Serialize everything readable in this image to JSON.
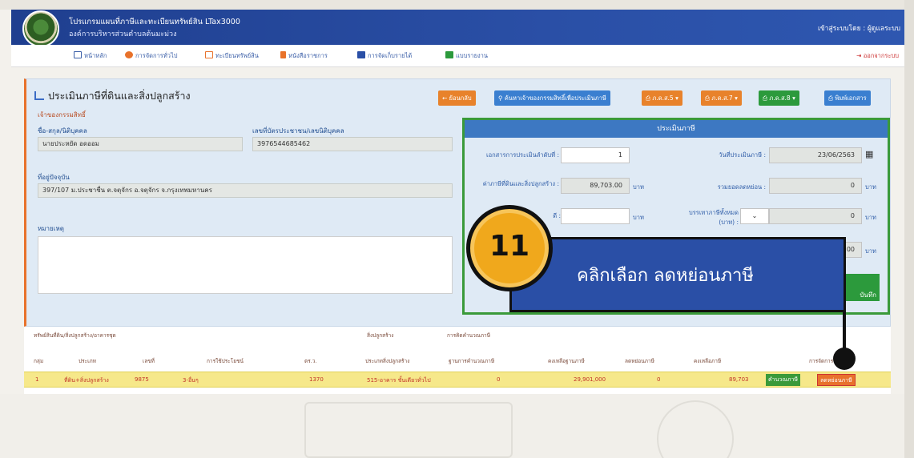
{
  "header": {
    "app_title": "โปรแกรมแผนที่ภาษีและทะเบียนทรัพย์สิน LTax3000",
    "org_name": "องค์การบริหารส่วนตำบลต้นมะม่วง",
    "login_info": "เข้าสู่ระบบโดย : ผู้ดูแลระบบ"
  },
  "nav": {
    "items": [
      {
        "label": "หน้าหลัก",
        "icon": "home-icon"
      },
      {
        "label": "การจัดการทั่วไป",
        "icon": "gear-icon"
      },
      {
        "label": "ทะเบียนทรัพย์สิน",
        "icon": "book-icon"
      },
      {
        "label": "หนังสือราชการ",
        "icon": "document-icon"
      },
      {
        "label": "การจัดเก็บรายได้",
        "icon": "calculator-icon"
      },
      {
        "label": "แบบรายงาน",
        "icon": "report-icon"
      }
    ],
    "logout": "ออกจากระบบ"
  },
  "panel": {
    "title": "ประเมินภาษีที่ดินและสิ่งปลูกสร้าง",
    "toolbar": {
      "back": "ย้อนกลับ",
      "search": "ค้นหาเจ้าของกรรมสิทธิ์เพื่อประเมินภาษี",
      "form5": "ภ.ด.ส.5",
      "form7": "ภ.ด.ส.7",
      "form8": "ภ.ด.ส.8",
      "print": "พิมพ์เอกสาร"
    },
    "owner_section": "เจ้าของกรรมสิทธิ์",
    "name_label": "ชื่อ-สกุล/นิติบุคคล",
    "name_value": "นายประหยัด อดออม",
    "id_label": "เลขที่บัตรประชาชน/เลขนิติบุคคล",
    "id_value": "3976544685462",
    "address_label": "ที่อยู่ปัจจุบัน",
    "address_value": "397/107 ม.ประชาชื่น ต.จตุจักร อ.จตุจักร จ.กรุงเทพมหานคร",
    "notes_label": "หมายเหตุ"
  },
  "assess": {
    "title": "ประเมินภาษี",
    "doc_no_label": "เอกสารการประเมินลำดับที่ :",
    "doc_no_value": "1",
    "date_label": "วันที่ประเมินภาษี :",
    "date_value": "23/06/2563",
    "tax_label": "ค่าภาษีที่ดินและสิ่งปลูกสร้าง :",
    "tax_value": "89,703.00",
    "unit_baht": "บาท",
    "discount_label": "รวมยอดลดหย่อน :",
    "discount_value": "0",
    "exempt_label": "บรรเทาภาษีทั้งหมด (บาท) :",
    "exempt_value": "0",
    "partial_label": "ดี :",
    "partial_value": "00",
    "save_button": "บันทึก"
  },
  "callout": {
    "step": "11",
    "text": "คลิกเลือก ลดหย่อนภาษี"
  },
  "table": {
    "group1": "ทรัพย์สินที่ดิน/สิ่งปลูกสร้าง/อาคารชุด",
    "group2": "สิ่งปลูกสร้าง",
    "group3": "การคิดคำนวณภาษี",
    "columns": [
      "กลุ่ม",
      "ประเภท",
      "เลขที่",
      "การใช้ประโยชน์",
      "ตร.ว.",
      "ประเภทสิ่งปลูกสร้าง",
      "ฐานการคำนวณภาษี",
      "คงเหลือฐานภาษี",
      "ลดหย่อนภาษี",
      "คงเหลือภาษี",
      "การจัดการ"
    ],
    "rows": [
      {
        "group": "1",
        "type": "ที่ดิน+สิ่งปลูกสร้าง",
        "number": "9875",
        "usage": "3-อื่นๆ",
        "area": "1370",
        "building_type": "515-อาคาร ชั้นเดียวทั่วไป",
        "base": "0",
        "remaining_base": "29,901,000",
        "discount": "0",
        "remaining_tax": "89,703",
        "btn_assess": "คำนวณภาษี",
        "btn_discount": "ลดหย่อนภาษี"
      }
    ]
  }
}
